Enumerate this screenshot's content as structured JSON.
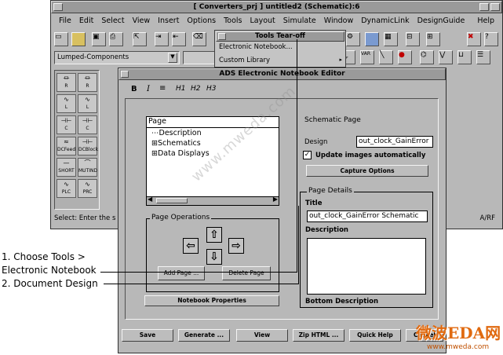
{
  "app_window": {
    "title": "[ Converters_prj ] untitled2 (Schematic):6",
    "menu": [
      "File",
      "Edit",
      "Select",
      "View",
      "Insert",
      "Options",
      "Tools",
      "Layout",
      "Simulate",
      "Window",
      "DynamicLink",
      "DesignGuide",
      "Help"
    ],
    "palette_dropdown": "Lumped-Components",
    "palette_items": [
      "R",
      "L",
      "L",
      "C",
      "C",
      "DCFeed",
      "DCBlock",
      "SHORT",
      "MUTIND",
      "PLC",
      "PRC"
    ],
    "status_text": "Select: Enter the s",
    "status_right": "A/RF"
  },
  "tools_menu": {
    "header": "Tools Tear-off",
    "items": [
      "Electronic Notebook...",
      "Custom Library"
    ]
  },
  "notebook": {
    "title": "ADS Electronic Notebook Editor",
    "format_toolbar": [
      "B",
      "I",
      "≡",
      "H1",
      "H2",
      "H3"
    ],
    "tree_header": "Page",
    "tree_items": [
      "Description",
      "Schematics",
      "Data Displays"
    ],
    "page_operations_label": "Page Operations",
    "add_page": "Add Page ...",
    "delete_page": "Delete Page",
    "notebook_properties": "Notebook Properties",
    "schematic_page_label": "Schematic Page",
    "design_label": "Design",
    "design_value": "out_clock_GainError",
    "update_images_label": "Update images automatically",
    "update_images_checked": true,
    "capture_options": "Capture Options",
    "page_details_label": "Page Details",
    "title_label": "Title",
    "title_value": "out_clock_GainError Schematic",
    "description_label": "Description",
    "bottom_description_label": "Bottom Description",
    "bottom_buttons": [
      "Save",
      "Generate ...",
      "View",
      "Zip HTML ...",
      "Quick Help",
      "Cancel"
    ]
  },
  "callouts": {
    "step1_line1": "1. Choose Tools >",
    "step1_line2": "Electronic Notebook",
    "step2": "2. Document Design"
  },
  "watermark": {
    "diagonal": "www.mweda.com",
    "logo": "微波EDA网",
    "logo_url": "www.mweda.com"
  }
}
